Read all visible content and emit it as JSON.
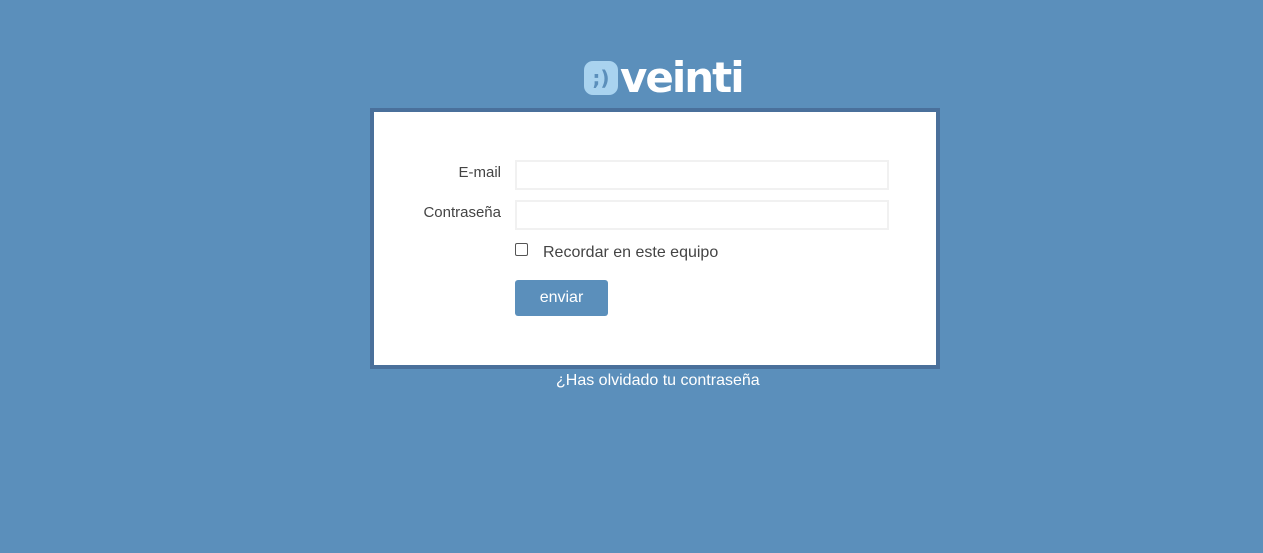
{
  "brand": {
    "logo_text": "veinti",
    "logo_badge_glyph": ";)",
    "logo_badge_color": "#a9d3ef"
  },
  "colors": {
    "background": "#5b8fbb",
    "card_border": "#4a709b",
    "button": "#5b8fbb"
  },
  "form": {
    "email_label": "E-mail",
    "email_value": "",
    "password_label": "Contraseña",
    "password_value": "",
    "remember_label": "Recordar en este equipo",
    "remember_checked": false,
    "submit_label": "enviar"
  },
  "footer": {
    "forgot_link": "¿Has olvidado tu contraseña"
  }
}
